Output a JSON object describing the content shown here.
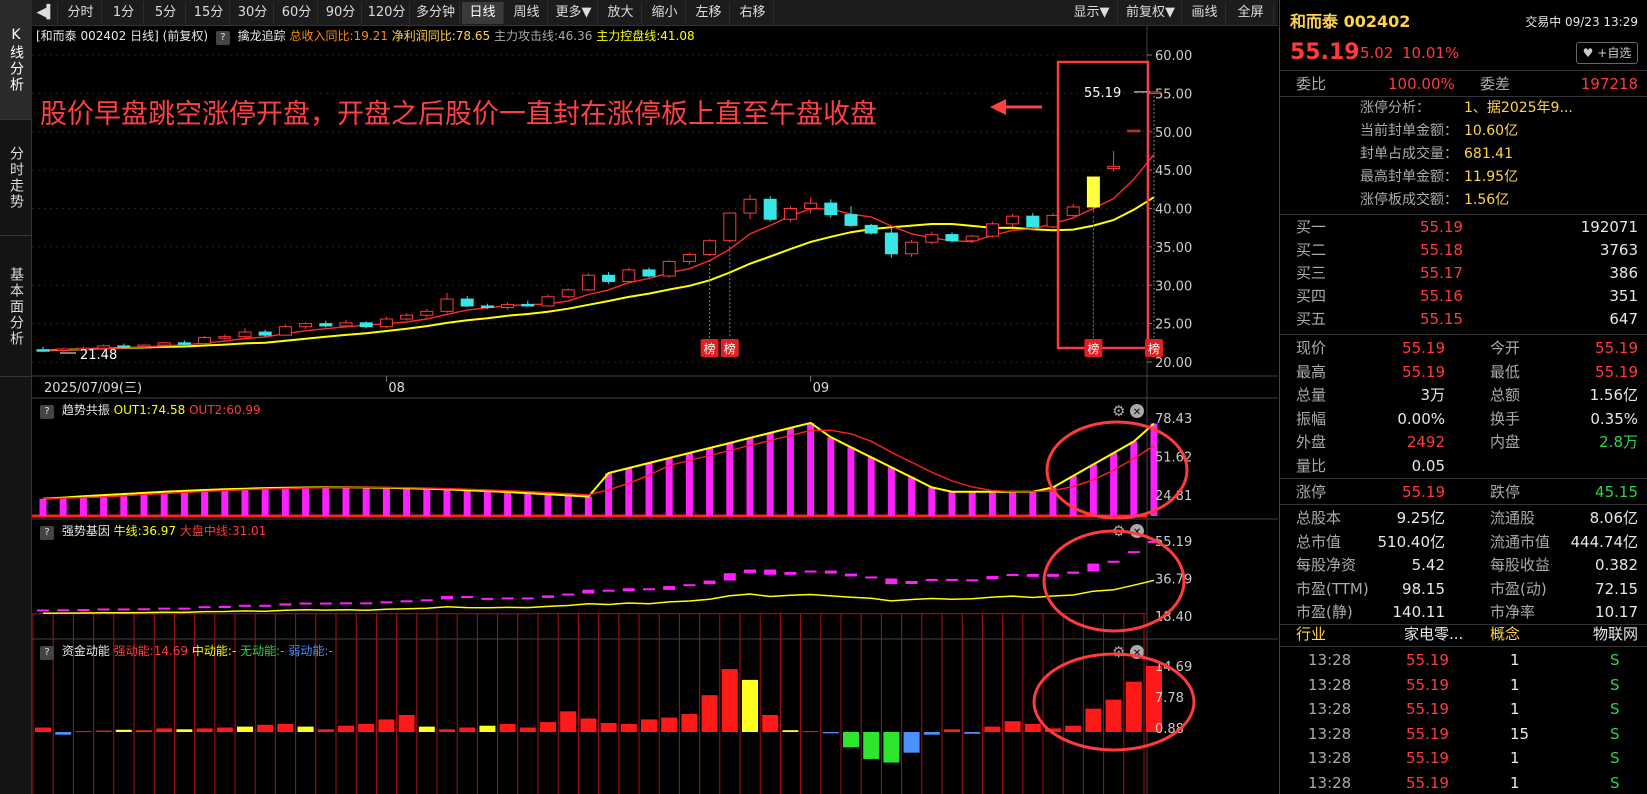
{
  "left_tabs": [
    "K线分析",
    "分时走势",
    "基本面分析"
  ],
  "toolbar": {
    "buttons": [
      "分时",
      "1分",
      "5分",
      "15分",
      "30分",
      "60分",
      "90分",
      "120分",
      "多分钟",
      "日线",
      "周线",
      "更多▼",
      "放大",
      "缩小",
      "左移",
      "右移"
    ],
    "active": "日线",
    "right_buttons": [
      "显示▼",
      "前复权▼",
      "画线",
      "全屏"
    ]
  },
  "main_info": {
    "title": "[和而泰 002402 日线]",
    "adjust": "(前复权)",
    "indicator_name": "擒龙追踪",
    "revenue_label": "总收入同比:19.21",
    "profit_label": "净利润同比:78.65",
    "attack_label": "主力攻击线:46.36",
    "control_label": "主力控盘线:41.08"
  },
  "annotation_text": "股价早盘跳空涨停开盘，开盘之后股价一直封在涨停板上直至午盘收盘",
  "price_label": "55.19",
  "low_label": "21.48",
  "bang_label": "榜",
  "price_axis": [
    "60.00",
    "55.00",
    "50.00",
    "45.00",
    "40.00",
    "35.00",
    "30.00",
    "25.00",
    "20.00"
  ],
  "date_axis": {
    "start": "2025/07/09(三)",
    "m1": "08",
    "m2": "09"
  },
  "panel1": {
    "name": "趋势共振",
    "out1": "OUT1:74.58",
    "out2": "OUT2:60.99",
    "axis": [
      "78.43",
      "51.62",
      "24.81"
    ]
  },
  "panel2": {
    "name": "强势基因",
    "bull": "牛线:36.97",
    "market": "大盘中线:31.01",
    "axis": [
      "55.19",
      "36.79",
      "18.40"
    ]
  },
  "panel3": {
    "name": "资金动能",
    "strong": "强动能:14.69",
    "mid": "中动能:-",
    "none": "无动能:-",
    "weak": "弱动能:-",
    "axis": [
      "14.69",
      "7.78",
      "0.88"
    ]
  },
  "chart_data": {
    "type": "candlestick",
    "title": "和而泰 002402 日线",
    "y_range": [
      20,
      60
    ],
    "ohlc": [
      [
        21.6,
        22.0,
        21.3,
        21.5
      ],
      [
        21.5,
        21.8,
        21.3,
        21.7
      ],
      [
        21.7,
        22.0,
        21.5,
        21.8
      ],
      [
        21.8,
        22.3,
        21.6,
        22.1
      ],
      [
        22.1,
        22.4,
        21.8,
        22.0
      ],
      [
        22.0,
        22.3,
        21.8,
        22.2
      ],
      [
        22.2,
        22.6,
        22.0,
        22.5
      ],
      [
        22.5,
        22.8,
        22.2,
        22.4
      ],
      [
        22.4,
        23.4,
        22.3,
        23.2
      ],
      [
        23.2,
        23.6,
        22.9,
        23.3
      ],
      [
        23.3,
        24.4,
        23.1,
        23.9
      ],
      [
        23.9,
        24.2,
        23.3,
        23.5
      ],
      [
        23.5,
        24.9,
        23.4,
        24.6
      ],
      [
        24.6,
        25.2,
        24.3,
        25.0
      ],
      [
        25.0,
        25.4,
        24.5,
        24.7
      ],
      [
        24.7,
        25.5,
        24.5,
        25.1
      ],
      [
        25.1,
        25.3,
        24.4,
        24.6
      ],
      [
        24.6,
        25.9,
        24.4,
        25.6
      ],
      [
        25.6,
        26.4,
        25.4,
        26.1
      ],
      [
        26.1,
        26.9,
        25.8,
        26.6
      ],
      [
        26.6,
        29.0,
        26.4,
        28.2
      ],
      [
        28.2,
        28.6,
        27.1,
        27.3
      ],
      [
        27.3,
        27.6,
        26.9,
        27.1
      ],
      [
        27.1,
        27.8,
        26.8,
        27.5
      ],
      [
        27.5,
        28.0,
        27.2,
        27.3
      ],
      [
        27.3,
        28.8,
        27.2,
        28.5
      ],
      [
        28.5,
        29.6,
        28.3,
        29.4
      ],
      [
        29.4,
        31.6,
        29.2,
        31.3
      ],
      [
        31.3,
        31.7,
        30.2,
        30.5
      ],
      [
        30.5,
        32.3,
        30.3,
        32.0
      ],
      [
        32.0,
        32.3,
        31.0,
        31.2
      ],
      [
        31.2,
        33.3,
        31.0,
        33.1
      ],
      [
        33.1,
        34.3,
        32.7,
        34.0
      ],
      [
        34.0,
        36.0,
        33.8,
        35.8
      ],
      [
        35.8,
        39.5,
        35.6,
        39.4
      ],
      [
        39.4,
        41.8,
        38.6,
        41.2
      ],
      [
        41.2,
        41.6,
        38.3,
        38.6
      ],
      [
        38.6,
        40.3,
        38.2,
        40.0
      ],
      [
        40.0,
        41.4,
        39.4,
        40.7
      ],
      [
        40.7,
        41.2,
        38.8,
        39.2
      ],
      [
        39.2,
        40.3,
        37.6,
        37.8
      ],
      [
        37.8,
        38.0,
        36.6,
        36.8
      ],
      [
        36.8,
        37.4,
        33.6,
        34.1
      ],
      [
        34.1,
        35.9,
        33.7,
        35.6
      ],
      [
        35.6,
        37.0,
        35.3,
        36.6
      ],
      [
        36.6,
        36.9,
        35.6,
        35.8
      ],
      [
        35.8,
        36.6,
        35.5,
        36.4
      ],
      [
        36.4,
        38.3,
        36.2,
        38.0
      ],
      [
        38.0,
        39.3,
        37.6,
        39.0
      ],
      [
        39.0,
        39.4,
        37.4,
        37.6
      ],
      [
        37.6,
        39.4,
        37.4,
        39.1
      ],
      [
        39.1,
        40.6,
        38.7,
        40.2
      ],
      [
        40.2,
        44.2,
        39.5,
        44.1
      ],
      [
        45.2,
        47.5,
        44.8,
        45.5
      ],
      [
        50.2,
        50.2,
        50.2,
        50.2
      ],
      [
        55.19,
        55.19,
        55.19,
        55.19
      ]
    ],
    "ma5_end": 46.36,
    "ma10_end": 41.08,
    "current_price": 55.19,
    "period_low": 21.48
  },
  "right_panel": {
    "stock_name": "和而泰 002402",
    "status": "交易中 09/23 13:29",
    "price": "55.19",
    "change": "5.02",
    "change_pct": "10.01%",
    "add_watch": "+自选",
    "weibi_label": "委比",
    "weibi": "100.00%",
    "weicha_label": "委差",
    "weicha": "197218",
    "limit_analysis_label": "涨停分析：",
    "limit_analysis": "1、据2025年9...",
    "seal_amount_label": "当前封单金额：",
    "seal_amount": "10.60亿",
    "seal_ratio_label": "封单占成交量：",
    "seal_ratio": "681.41",
    "max_seal_label": "最高封单金额：",
    "max_seal": "11.95亿",
    "limit_turnover_label": "涨停板成交额：",
    "limit_turnover": "1.56亿",
    "bids": [
      {
        "label": "买一",
        "price": "55.19",
        "vol": "192071"
      },
      {
        "label": "买二",
        "price": "55.18",
        "vol": "3763"
      },
      {
        "label": "买三",
        "price": "55.17",
        "vol": "386"
      },
      {
        "label": "买四",
        "price": "55.16",
        "vol": "351"
      },
      {
        "label": "买五",
        "price": "55.15",
        "vol": "647"
      }
    ],
    "stats": [
      {
        "l1": "现价",
        "v1": "55.19",
        "c1": "red",
        "l2": "今开",
        "v2": "55.19",
        "c2": "red"
      },
      {
        "l1": "最高",
        "v1": "55.19",
        "c1": "red",
        "l2": "最低",
        "v2": "55.19",
        "c2": "red"
      },
      {
        "l1": "总量",
        "v1": "3万",
        "c1": "white",
        "l2": "总额",
        "v2": "1.56亿",
        "c2": "white"
      },
      {
        "l1": "振幅",
        "v1": "0.00%",
        "c1": "white",
        "l2": "换手",
        "v2": "0.35%",
        "c2": "white"
      },
      {
        "l1": "外盘",
        "v1": "2492",
        "c1": "red",
        "l2": "内盘",
        "v2": "2.8万",
        "c2": "green"
      },
      {
        "l1": "量比",
        "v1": "0.05",
        "c1": "white",
        "l2": "",
        "v2": "",
        "c2": "white"
      }
    ],
    "limits": {
      "up_label": "涨停",
      "up": "55.19",
      "down_label": "跌停",
      "down": "45.15"
    },
    "fundamentals": [
      {
        "l1": "总股本",
        "v1": "9.25亿",
        "l2": "流通股",
        "v2": "8.06亿"
      },
      {
        "l1": "总市值",
        "v1": "510.40亿",
        "l2": "流通市值",
        "v2": "444.74亿"
      },
      {
        "l1": "每股净资",
        "v1": "5.42",
        "l2": "每股收益",
        "v2": "0.382"
      },
      {
        "l1": "市盈(TTM)",
        "v1": "98.15",
        "l2": "市盈(动)",
        "v2": "72.15"
      },
      {
        "l1": "市盈(静)",
        "v1": "140.11",
        "l2": "市净率",
        "v2": "10.17"
      }
    ],
    "industry_label": "行业",
    "industry": "家电零...",
    "concept_label": "概念",
    "concept": "物联网",
    "ticks": [
      {
        "time": "13:28",
        "price": "55.19",
        "vol": "1",
        "side": "S"
      },
      {
        "time": "13:28",
        "price": "55.19",
        "vol": "1",
        "side": "S"
      },
      {
        "time": "13:28",
        "price": "55.19",
        "vol": "1",
        "side": "S"
      },
      {
        "time": "13:28",
        "price": "55.19",
        "vol": "15",
        "side": "S"
      },
      {
        "time": "13:28",
        "price": "55.19",
        "vol": "1",
        "side": "S"
      },
      {
        "time": "13:28",
        "price": "55.19",
        "vol": "1",
        "side": "S"
      }
    ]
  }
}
